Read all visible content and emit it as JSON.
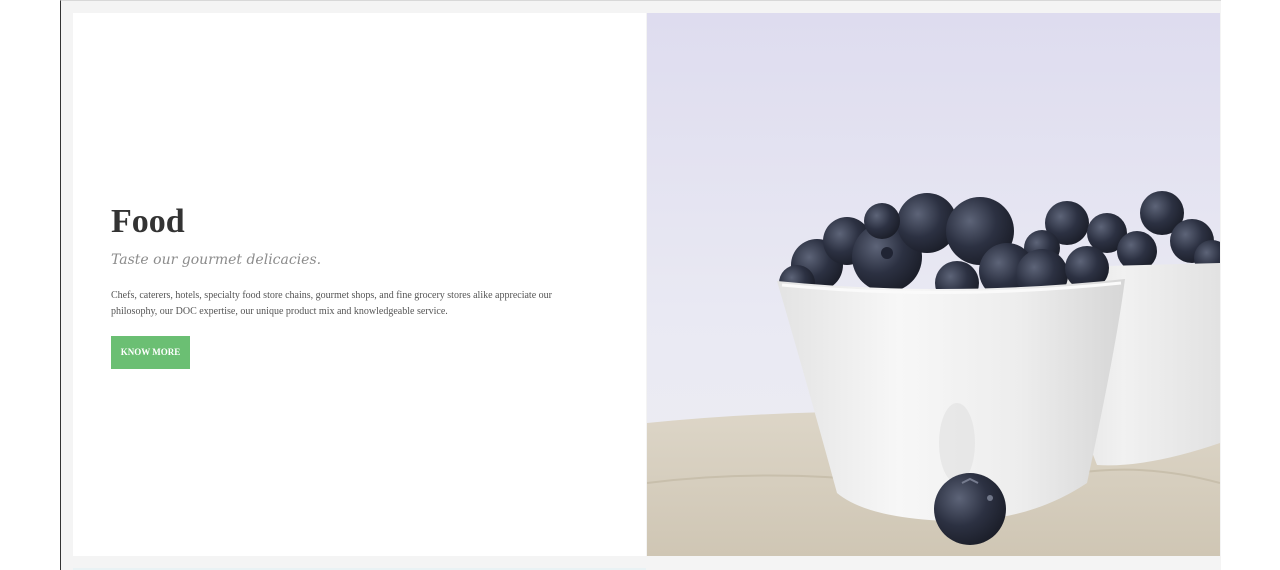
{
  "section": {
    "title": "Food",
    "subtitle": "Taste our gourmet delicacies.",
    "description": "Chefs, caterers, hotels, specialty food store chains, gourmet shops, and fine grocery stores alike appreciate our philosophy, our DOC expertise, our unique product mix and knowledgeable service.",
    "button_label": "KNOW MORE"
  },
  "colors": {
    "accent": "#6bbf73",
    "title": "#333333",
    "subtitle": "#8c8c8c",
    "body_text": "#555555"
  },
  "image": {
    "subject": "blueberries-in-white-bowls"
  }
}
